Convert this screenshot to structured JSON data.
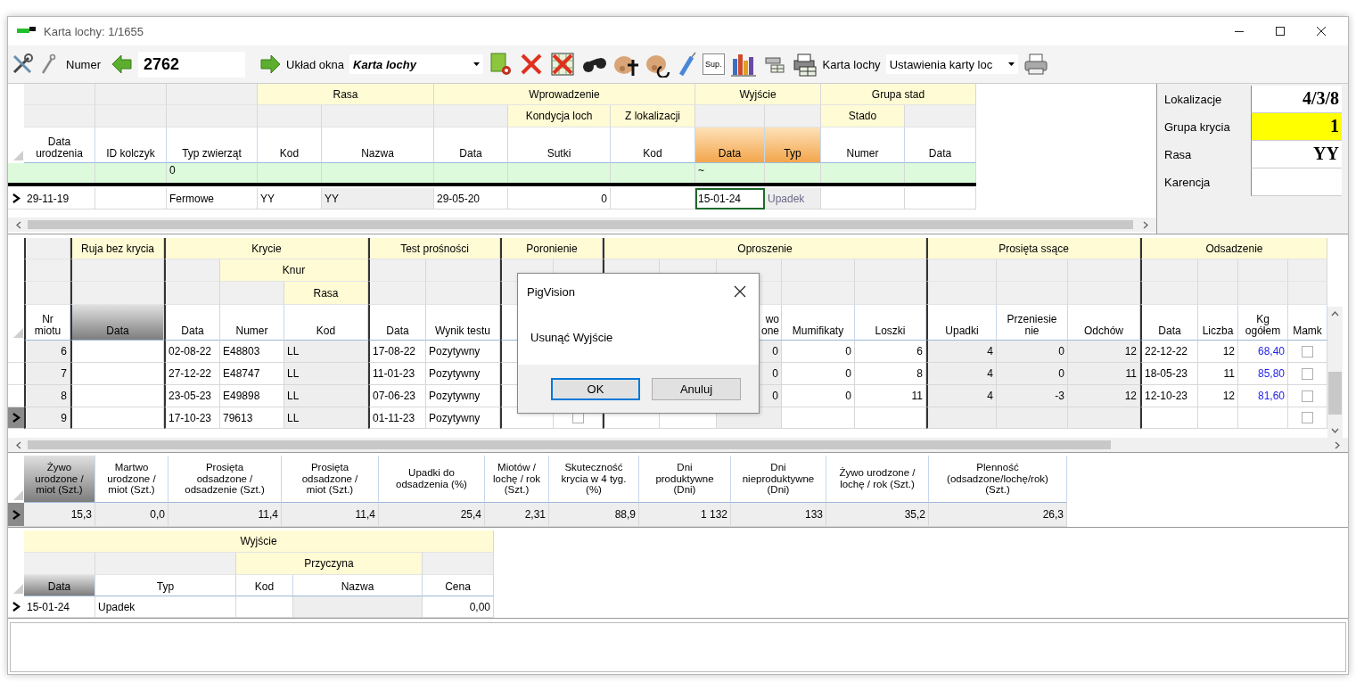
{
  "window": {
    "title": "Karta lochy: 1/1655"
  },
  "toolbar": {
    "number_label": "Numer",
    "number_value": "2762",
    "layout_label": "Układ okna",
    "layout_value": "Karta lochy",
    "sup_text": "Sup.",
    "card_label": "Karta lochy",
    "settings_value": "Ustawienia karty loc"
  },
  "sow_grid": {
    "columns": [
      {
        "label": "Data\nurodzenia",
        "kind": "text",
        "readonly": false,
        "sorted": false,
        "highlighted": false
      },
      {
        "label": "ID kolczyk",
        "kind": "text",
        "readonly": false,
        "sorted": false,
        "highlighted": false
      },
      {
        "label": "Typ zwierząt",
        "kind": "text",
        "readonly": false,
        "sorted": false,
        "highlighted": false,
        "filter": "0"
      },
      {
        "group": "Rasa",
        "children": [
          {
            "label": "Kod",
            "kind": "text",
            "readonly": false,
            "sorted": false,
            "highlighted": false
          },
          {
            "label": "Nazwa",
            "kind": "text",
            "readonly": true,
            "sorted": false,
            "highlighted": false
          }
        ]
      },
      {
        "group": "Wprowadzenie",
        "children": [
          {
            "label": "Data",
            "kind": "text",
            "readonly": false,
            "sorted": false,
            "highlighted": false
          },
          {
            "group": "Kondycja loch",
            "children": [
              {
                "label": "Sutki",
                "kind": "number",
                "readonly": false,
                "sorted": false,
                "highlighted": false
              }
            ]
          },
          {
            "group": "Z lokalizacji",
            "children": [
              {
                "label": "Kod",
                "kind": "text",
                "readonly": false,
                "sorted": false,
                "highlighted": false
              }
            ]
          }
        ]
      },
      {
        "group": "Wyjście",
        "children": [
          {
            "label": "Data",
            "kind": "text",
            "readonly": false,
            "sorted": false,
            "highlighted": true,
            "filter": "~"
          },
          {
            "label": "Typ",
            "kind": "lookup",
            "readonly": true,
            "sorted": false,
            "highlighted": true
          }
        ]
      },
      {
        "group": "Grupa stad",
        "children": [
          {
            "group": "Stado",
            "children": [
              {
                "label": "Numer",
                "kind": "text",
                "readonly": false,
                "sorted": false,
                "highlighted": false
              }
            ]
          },
          {
            "label": "Data",
            "kind": "text",
            "readonly": false,
            "sorted": false,
            "highlighted": false
          }
        ]
      }
    ],
    "rows": [
      {
        "current": true,
        "birth_date": "29-11-19",
        "animal_type": "Fermowe",
        "breed_code": "YY",
        "breed_name": "YY",
        "entry_date": "29-05-20",
        "teats": "0",
        "exit_date": {
          "text": "15-01-24",
          "selected": true
        },
        "exit_type": {
          "text": "Upadek",
          "selected": false
        }
      }
    ]
  },
  "info_panel": [
    {
      "label": "Lokalizacje",
      "value": "4/3/8",
      "highlighted": false
    },
    {
      "label": "Grupa krycia",
      "value": "1",
      "highlighted": true
    },
    {
      "label": "Rasa",
      "value": "YY",
      "highlighted": false
    },
    {
      "label": "Karencja",
      "highlighted": false
    }
  ],
  "litter_grid": {
    "columns": [
      {
        "label": "Nr\nmiotu",
        "kind": "number",
        "readonly": true,
        "sorted": false,
        "highlighted": false
      },
      {
        "group": "Ruja bez krycia",
        "children": [
          {
            "label": "Data",
            "kind": "text",
            "readonly": false,
            "sorted": true,
            "highlighted": false
          }
        ]
      },
      {
        "group": "Krycie",
        "children": [
          {
            "label": "Data",
            "kind": "text",
            "readonly": false,
            "sorted": false,
            "highlighted": false
          },
          {
            "group": "Knur",
            "children": [
              {
                "label": "Numer",
                "kind": "text",
                "readonly": false,
                "sorted": false,
                "highlighted": false
              },
              {
                "group": "Rasa",
                "children": [
                  {
                    "label": "Kod",
                    "kind": "text",
                    "readonly": true,
                    "sorted": false,
                    "highlighted": false
                  }
                ]
              }
            ]
          }
        ]
      },
      {
        "group": "Test prośności",
        "children": [
          {
            "label": "Data",
            "kind": "text",
            "readonly": false,
            "sorted": false,
            "highlighted": false
          },
          {
            "label": "Wynik testu",
            "kind": "text",
            "readonly": false,
            "sorted": false,
            "highlighted": false
          }
        ]
      },
      {
        "group": "Poronienie",
        "children": [
          {
            "kind": "text"
          },
          {
            "kind": "check"
          }
        ]
      },
      {
        "group": "Oproszenie",
        "children": [
          {
            "kind": "number"
          },
          {
            "kind": "number"
          },
          {
            "label": "wo\none",
            "kind": "number",
            "readonly": true,
            "sorted": false,
            "highlighted": false
          },
          {
            "label": "Mumifikaty",
            "kind": "number",
            "readonly": false,
            "sorted": false,
            "highlighted": false
          },
          {
            "label": "Loszki",
            "kind": "number",
            "readonly": false,
            "sorted": false,
            "highlighted": false
          }
        ]
      },
      {
        "group": "Prosięta ssące",
        "children": [
          {
            "label": "Upadki",
            "kind": "number",
            "readonly": true,
            "sorted": false,
            "highlighted": false
          },
          {
            "label": "Przeniesie\nnie",
            "kind": "number",
            "readonly": true,
            "sorted": false,
            "highlighted": false
          },
          {
            "label": "Odchów",
            "kind": "number",
            "readonly": true,
            "sorted": false,
            "highlighted": false
          }
        ]
      },
      {
        "group": "Odsadzenie",
        "children": [
          {
            "label": "Data",
            "kind": "text",
            "readonly": false,
            "sorted": false,
            "highlighted": false
          },
          {
            "label": "Liczba",
            "kind": "number",
            "readonly": false,
            "sorted": false,
            "highlighted": false
          },
          {
            "label": "Kg\nogółem",
            "kind": "weight",
            "readonly": false,
            "sorted": false,
            "highlighted": false
          },
          {
            "label": "Mamk",
            "kind": "check",
            "readonly": false,
            "sorted": false,
            "highlighted": false
          }
        ]
      }
    ],
    "rows": [
      {
        "current": false,
        "litter_no": "6",
        "mating_date": "02-08-22",
        "boar_number": "E48803",
        "boar_breed": "LL",
        "test_date": "17-08-22",
        "test_result": "Pozytywny",
        "column_12": "0",
        "mummified": "0",
        "gilts": "6",
        "deaths": "4",
        "transfer": "0",
        "weaned": "12",
        "wean_date": "22-12-22",
        "wean_count": "12",
        "wean_kg": "68,40",
        "foster": {
          "checked": false
        }
      },
      {
        "current": false,
        "litter_no": "7",
        "mating_date": "27-12-22",
        "boar_number": "E48747",
        "boar_breed": "LL",
        "test_date": "11-01-23",
        "test_result": "Pozytywny",
        "column_12": "0",
        "mummified": "0",
        "gilts": "8",
        "deaths": "4",
        "transfer": "0",
        "weaned": "11",
        "wean_date": "18-05-23",
        "wean_count": "11",
        "wean_kg": "85,80",
        "foster": {
          "checked": false
        }
      },
      {
        "current": false,
        "litter_no": "8",
        "mating_date": "23-05-23",
        "boar_number": "E49898",
        "boar_breed": "LL",
        "test_date": "07-06-23",
        "test_result": "Pozytywny",
        "column_12": "0",
        "mummified": "0",
        "gilts": "11",
        "deaths": "4",
        "transfer": "-3",
        "weaned": "12",
        "wean_date": "12-10-23",
        "wean_count": "12",
        "wean_kg": "81,60",
        "foster": {
          "checked": false
        }
      },
      {
        "current": true,
        "litter_no": "9",
        "mating_date": "17-10-23",
        "boar_number": "79613",
        "boar_breed": "LL",
        "test_date": "01-11-23",
        "test_result": "Pozytywny",
        "column_9": {
          "checked": false
        },
        "foster": {
          "checked": false
        }
      }
    ]
  },
  "stats_grid": {
    "columns": [
      {
        "label": "Żywo\nurodzone /\nmiot (Szt.)",
        "kind": "number",
        "readonly": true,
        "sorted": true,
        "highlighted": false
      },
      {
        "label": "Martwo\nurodzone /\nmiot (Szt.)",
        "kind": "number",
        "readonly": true,
        "sorted": false,
        "highlighted": false
      },
      {
        "label": "Prosięta\nodsadzone /\nodsadzenie (Szt.)",
        "kind": "number",
        "readonly": true,
        "sorted": false,
        "highlighted": false
      },
      {
        "label": "Prosięta\nodsadzone /\nmiot (Szt.)",
        "kind": "number",
        "readonly": true,
        "sorted": false,
        "highlighted": false
      },
      {
        "label": "Upadki do\nodsadzenia (%)",
        "kind": "number",
        "readonly": true,
        "sorted": false,
        "highlighted": false
      },
      {
        "label": "Miotów /\nlochę / rok\n(Szt.)",
        "kind": "number",
        "readonly": true,
        "sorted": false,
        "highlighted": false
      },
      {
        "label": "Skuteczność\nkrycia w 4 tyg.\n(%)",
        "kind": "number",
        "readonly": true,
        "sorted": false,
        "highlighted": false
      },
      {
        "label": "Dni\nproduktywne\n(Dni)",
        "kind": "number",
        "readonly": true,
        "sorted": false,
        "highlighted": false
      },
      {
        "label": "Dni\nnieproduktywne\n(Dni)",
        "kind": "number",
        "readonly": true,
        "sorted": false,
        "highlighted": false
      },
      {
        "label": "Żywo urodzone /\nlochę / rok (Szt.)",
        "kind": "number",
        "readonly": true,
        "sorted": false,
        "highlighted": false
      },
      {
        "label": "Plenność\n(odsadzone/lochę/rok)\n(Szt.)",
        "kind": "number",
        "readonly": true,
        "sorted": false,
        "highlighted": false
      }
    ],
    "rows": [
      {
        "current": true,
        "live_born": "15,3",
        "stillborn": "0,0",
        "weaned_per_weaning": "11,4",
        "weaned_per_litter": "11,4",
        "pre_wean_mortality": "25,4",
        "litters_per_year": "2,31",
        "mating_success": "88,9",
        "productive_days": "1 132",
        "nonproductive_days": "133",
        "live_born_per_year": "35,2",
        "prolificacy": "26,3"
      }
    ]
  },
  "exit_grid": {
    "columns": [
      {
        "group": "Wyjście",
        "children": [
          {
            "label": "Data",
            "kind": "text",
            "readonly": false,
            "sorted": true,
            "highlighted": false
          },
          {
            "label": "Typ",
            "kind": "text",
            "readonly": false,
            "sorted": false,
            "highlighted": false
          },
          {
            "group": "Przyczyna",
            "children": [
              {
                "label": "Kod",
                "kind": "text",
                "readonly": false,
                "sorted": false,
                "highlighted": false
              },
              {
                "label": "Nazwa",
                "kind": "text",
                "readonly": true,
                "sorted": false,
                "highlighted": false
              }
            ]
          },
          {
            "label": "Cena",
            "kind": "number",
            "readonly": false,
            "sorted": false,
            "highlighted": false
          }
        ]
      }
    ],
    "rows": [
      {
        "current": true,
        "date": "15-01-24",
        "type": "Upadek",
        "price": "0,00"
      }
    ]
  },
  "dialog": {
    "title": "PigVision",
    "message": "Usunąć Wyjście",
    "buttons": [
      {
        "label": "OK",
        "default": true
      },
      {
        "label": "Anuluj",
        "default": false
      }
    ]
  }
}
